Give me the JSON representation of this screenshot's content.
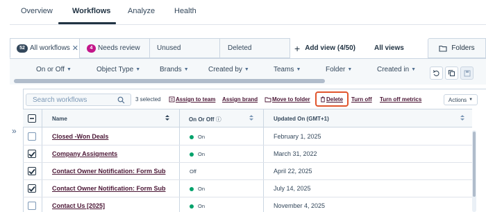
{
  "top_tabs": [
    {
      "label": "Overview",
      "active": false
    },
    {
      "label": "Workflows",
      "active": true
    },
    {
      "label": "Analyze",
      "active": false
    },
    {
      "label": "Health",
      "active": false
    }
  ],
  "view_tabs": [
    {
      "badge": "52",
      "label": "All workflows",
      "closable": true,
      "active": true
    },
    {
      "badge": "4",
      "label": "Needs review",
      "closable": false,
      "active": false
    },
    {
      "label": "Unused",
      "active": false
    },
    {
      "label": "Deleted",
      "active": false
    }
  ],
  "add_view_label": "Add view (4/50)",
  "all_views_label": "All views",
  "folders_label": "Folders",
  "filters": [
    "On or Off",
    "Object Type",
    "Brands",
    "Created by",
    "Teams",
    "Folder",
    "Created in"
  ],
  "search": {
    "placeholder": "Search workflows"
  },
  "selected_count_text": "3 selected",
  "bulk_actions": [
    "Assign to team",
    "Assign brand",
    "Move to folder",
    "Delete",
    "Turn off",
    "Turn off metrics"
  ],
  "actions_label": "Actions",
  "table": {
    "columns": [
      "Name",
      "On Or Off",
      "Updated On (GMT+1)"
    ],
    "rows": [
      {
        "name": "Closed -Won Deals",
        "checked": false,
        "status": "On",
        "status_on": true,
        "updated": "February 1, 2025"
      },
      {
        "name": "Company Assigments",
        "checked": true,
        "status": "On",
        "status_on": true,
        "updated": "March 31, 2022"
      },
      {
        "name": "Contact Owner Notification: Form Sub",
        "checked": true,
        "status": "Off",
        "status_on": false,
        "updated": "April 22, 2025"
      },
      {
        "name": "Contact Owner Notification: Form Sub",
        "checked": true,
        "status": "On",
        "status_on": true,
        "updated": "July 14, 2025"
      },
      {
        "name": "Contact Us [2025]",
        "checked": false,
        "status": "On",
        "status_on": true,
        "updated": "November 4, 2025"
      }
    ]
  },
  "colors": {
    "accent_link": "#4a1534",
    "highlight": "#e0542c",
    "status_on": "#00a26b",
    "badge_pink": "#c3168a"
  }
}
